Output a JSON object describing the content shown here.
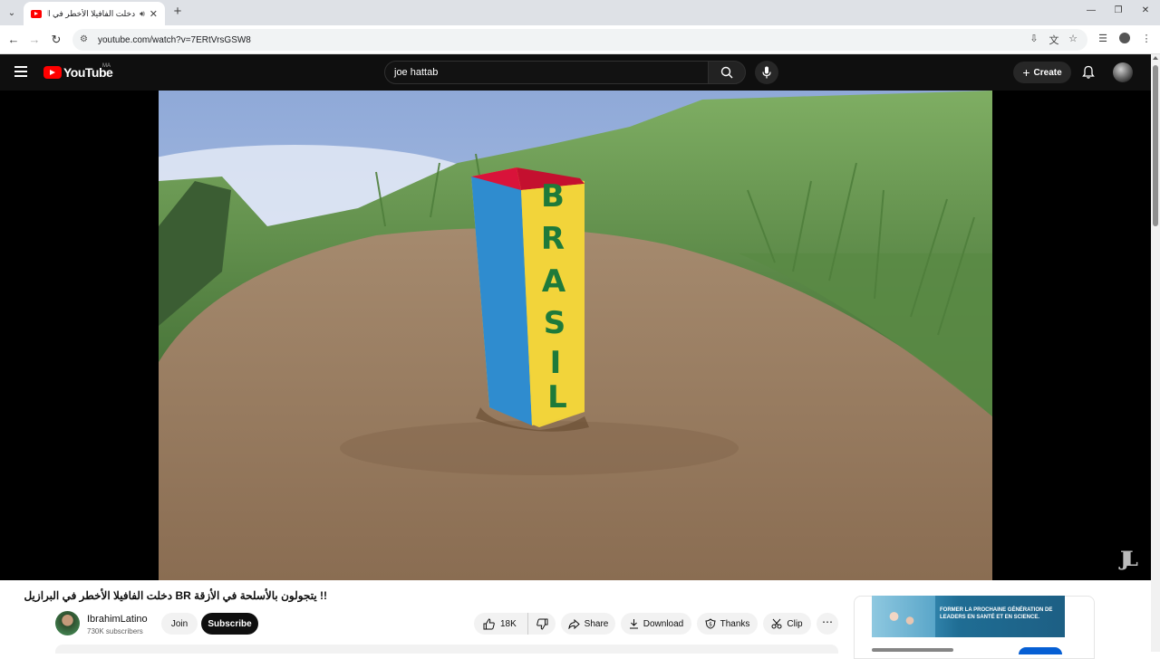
{
  "browser": {
    "tab_title": "دخلت الفافيلا الأخطر في البرا",
    "url": "youtube.com/watch?v=7ERtVrsGSW8"
  },
  "youtube": {
    "logo_text": "YouTube",
    "region": "MA",
    "search_value": "joe hattab",
    "create_label": "Create"
  },
  "video": {
    "title": "!! يتجولون بالأسلحة في الأزقة BR دخلت الفافيلا الأخطر في البرازيل",
    "post_text": "BRASIL",
    "watermark": "JL"
  },
  "channel": {
    "name": "IbrahimLatino",
    "subscribers": "730K subscribers",
    "join_label": "Join",
    "subscribe_label": "Subscribe"
  },
  "actions": {
    "likes": "18K",
    "share": "Share",
    "download": "Download",
    "thanks": "Thanks",
    "clip": "Clip"
  },
  "ad": {
    "text": "FORMER LA PROCHAINE GÉNÉRATION DE LEADERS EN SANTÉ ET EN SCIENCE."
  }
}
